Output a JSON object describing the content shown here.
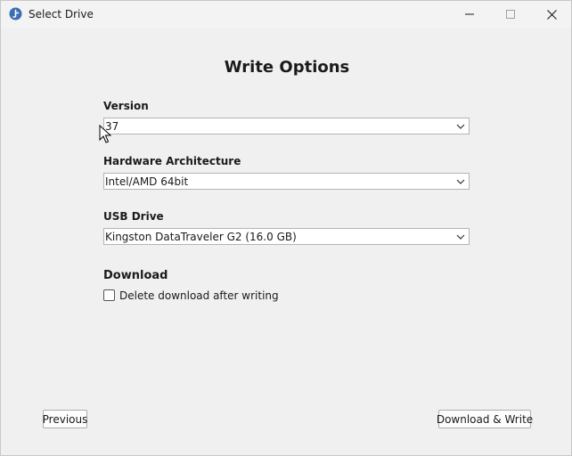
{
  "window": {
    "title": "Select Drive",
    "icon": "fedora-media-writer-icon"
  },
  "page": {
    "heading": "Write Options"
  },
  "fields": {
    "version": {
      "label": "Version",
      "value": "37"
    },
    "architecture": {
      "label": "Hardware Architecture",
      "value": "Intel/AMD 64bit"
    },
    "usb_drive": {
      "label": "USB Drive",
      "value": "Kingston DataTraveler G2 (16.0 GB)"
    }
  },
  "download": {
    "title": "Download",
    "delete_checkbox_label": "Delete download after writing",
    "delete_checked": false
  },
  "buttons": {
    "previous": "Previous",
    "download_write": "Download & Write"
  },
  "colors": {
    "background": "#f0f0f0",
    "text": "#1a1a1a",
    "app_icon": "#3c6eb4"
  }
}
